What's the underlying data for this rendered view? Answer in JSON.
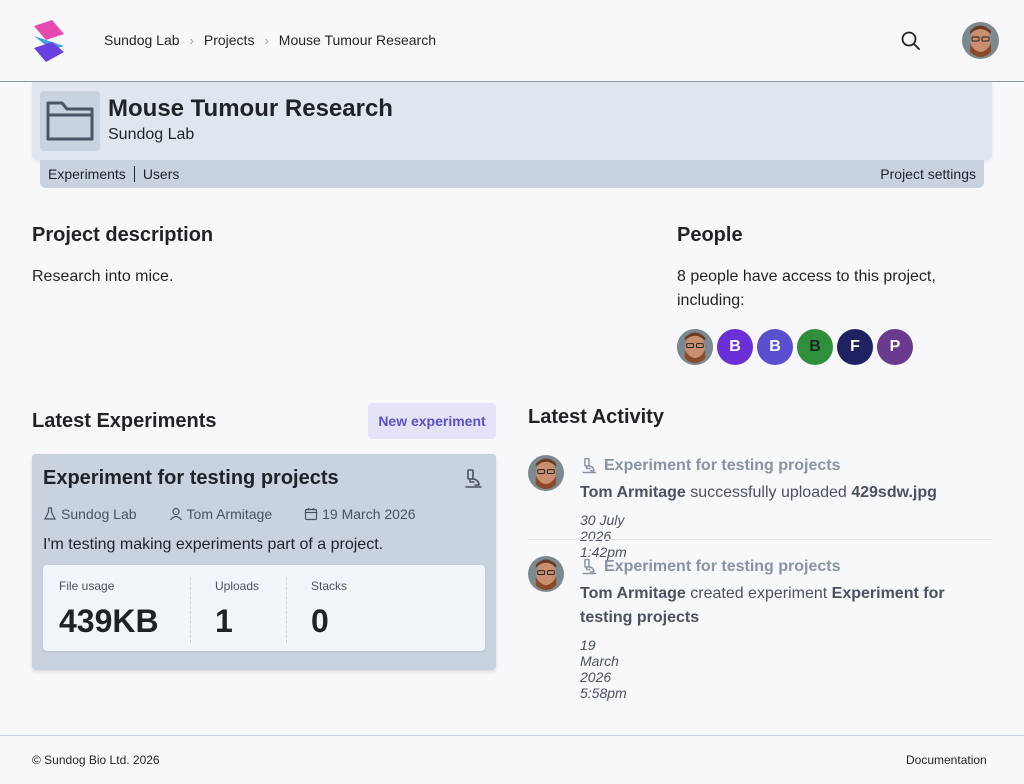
{
  "breadcrumbs": [
    "Sundog Lab",
    "Projects",
    "Mouse Tumour Research"
  ],
  "user": {
    "icon": "user-avatar"
  },
  "project": {
    "title": "Mouse Tumour Research",
    "lab": "Sundog Lab",
    "tabs": [
      "Experiments",
      "Users"
    ],
    "settings_label": "Project settings"
  },
  "description": {
    "heading": "Project description",
    "text": "Research into mice."
  },
  "people": {
    "heading": "People",
    "text": "8 people have access to this project, including:",
    "avatars": [
      {
        "initial": "",
        "color": "#8a6a52"
      },
      {
        "initial": "B",
        "color": "#6a2fd6"
      },
      {
        "initial": "B",
        "color": "#5a4fcf"
      },
      {
        "initial": "B",
        "color": "#2f8f3a",
        "text_color": "#1f2328"
      },
      {
        "initial": "F",
        "color": "#1f2160"
      },
      {
        "initial": "P",
        "color": "#6a3a8f"
      }
    ]
  },
  "experiments": {
    "heading": "Latest Experiments",
    "new_label": "New experiment",
    "card": {
      "title": "Experiment for testing projects",
      "lab": "Sundog Lab",
      "owner": "Tom Armitage",
      "date": "19 March 2026",
      "description": "I'm testing making experiments part of a project.",
      "stats": [
        {
          "label": "File usage",
          "value": "439KB"
        },
        {
          "label": "Uploads",
          "value": "1"
        },
        {
          "label": "Stacks",
          "value": "0"
        }
      ]
    }
  },
  "activity": {
    "heading": "Latest Activity",
    "items": [
      {
        "experiment": "Experiment for testing projects",
        "actor": "Tom Armitage",
        "verb": " successfully uploaded ",
        "object": "429sdw.jpg",
        "time": "30 July 2026 1:42pm"
      },
      {
        "experiment": "Experiment for testing projects",
        "actor": "Tom Armitage",
        "verb": " created experiment ",
        "object": "Experiment for testing projects",
        "time": "19 March 2026 5:58pm"
      }
    ]
  },
  "footer": {
    "copyright": "© Sundog Bio Ltd. 2026",
    "docs": "Documentation"
  }
}
